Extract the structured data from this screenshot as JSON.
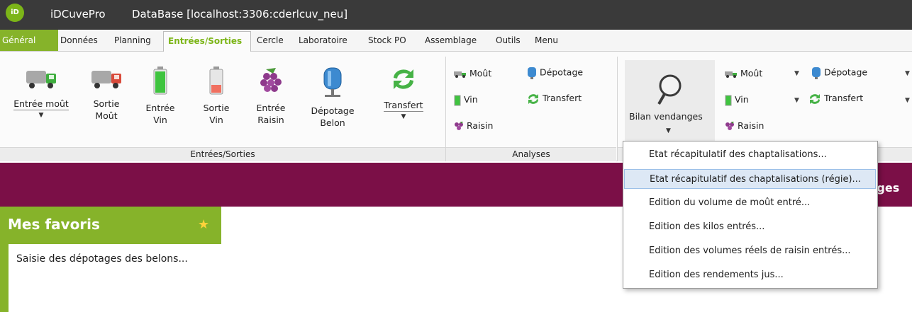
{
  "window": {
    "logo_text": "iD",
    "app_name": "iDCuvePro",
    "database_title": "DataBase [localhost:3306:cderlcuv_neu]"
  },
  "menu": {
    "general": "Général",
    "tabs": [
      "Données",
      "Planning",
      "Entrées/Sorties",
      "Cercle",
      "Laboratoire",
      "Stock PO",
      "Assemblage",
      "Outils",
      "Menu"
    ],
    "active_tab": "Entrées/Sorties"
  },
  "ribbon": {
    "entrees_sorties": {
      "group_label": "Entrées/Sorties",
      "buttons": [
        {
          "line1": "Entrée moût",
          "line2": "",
          "icon": "truck-green-icon",
          "dropdown": true
        },
        {
          "line1": "Sortie",
          "line2": "Moût",
          "icon": "truck-red-icon",
          "dropdown": false
        },
        {
          "line1": "Entrée",
          "line2": "Vin",
          "icon": "battery-full-icon",
          "dropdown": false
        },
        {
          "line1": "Sortie",
          "line2": "Vin",
          "icon": "battery-low-icon",
          "dropdown": false
        },
        {
          "line1": "Entrée",
          "line2": "Raisin",
          "icon": "grapes-icon",
          "dropdown": false
        },
        {
          "line1": "Dépotage",
          "line2": "Belon",
          "icon": "tank-icon",
          "dropdown": false
        },
        {
          "line1": "Transfert",
          "line2": "",
          "icon": "transfer-arrows-icon",
          "dropdown": true
        }
      ]
    },
    "analyses": {
      "group_label": "Analyses",
      "items": [
        "Moût",
        "Vin",
        "Raisin",
        "Dépotage",
        "Transfert"
      ]
    },
    "bilan": {
      "button_label": "Bilan vendanges",
      "icon": "magnifier-icon",
      "right_items": [
        "Moût",
        "Vin",
        "Raisin",
        "Dépotage",
        "Transfert"
      ]
    }
  },
  "bilan_menu": {
    "items": [
      "Etat récapitulatif des chaptalisations...",
      "Etat récapitulatif des chaptalisations (régie)...",
      "Edition du volume de moût entré...",
      "Edition des kilos entrés...",
      "Edition des volumes réels de raisin entrés...",
      "Edition des rendements jus..."
    ],
    "highlighted_index": 1
  },
  "banner": {
    "text": "nges"
  },
  "favorites": {
    "title": "Mes favoris",
    "items": [
      "Saisie des dépotages des belons..."
    ]
  },
  "colors": {
    "accent_green": "#86b32a",
    "banner_purple": "#7b0f47",
    "titlebar": "#3a3a3a"
  }
}
